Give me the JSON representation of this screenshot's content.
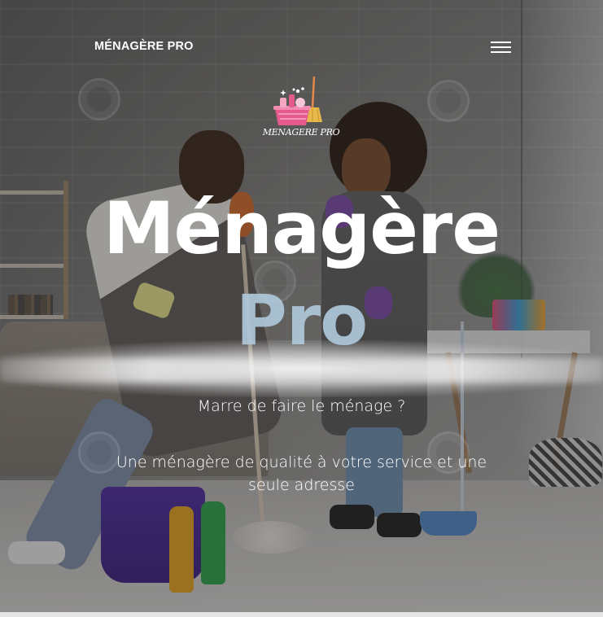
{
  "navbar": {
    "brand": "MÉNAGÈRE PRO",
    "menu_icon": "hamburger-menu-icon"
  },
  "logo": {
    "text": "MENAGERE PRO",
    "icon": "cleaning-basket-broom-icon"
  },
  "hero": {
    "title_line1": "Ménagère",
    "title_line2": "Pro",
    "tagline": "Marre de faire le ménage ?",
    "subtitle": "Une ménagère de qualité à votre service et une seule adresse"
  },
  "colors": {
    "title": "#ffffff",
    "title_accent": "#afc8da",
    "overlay": "#232323",
    "logo_pink": "#e45a8c",
    "logo_gold": "#e7b84a"
  }
}
